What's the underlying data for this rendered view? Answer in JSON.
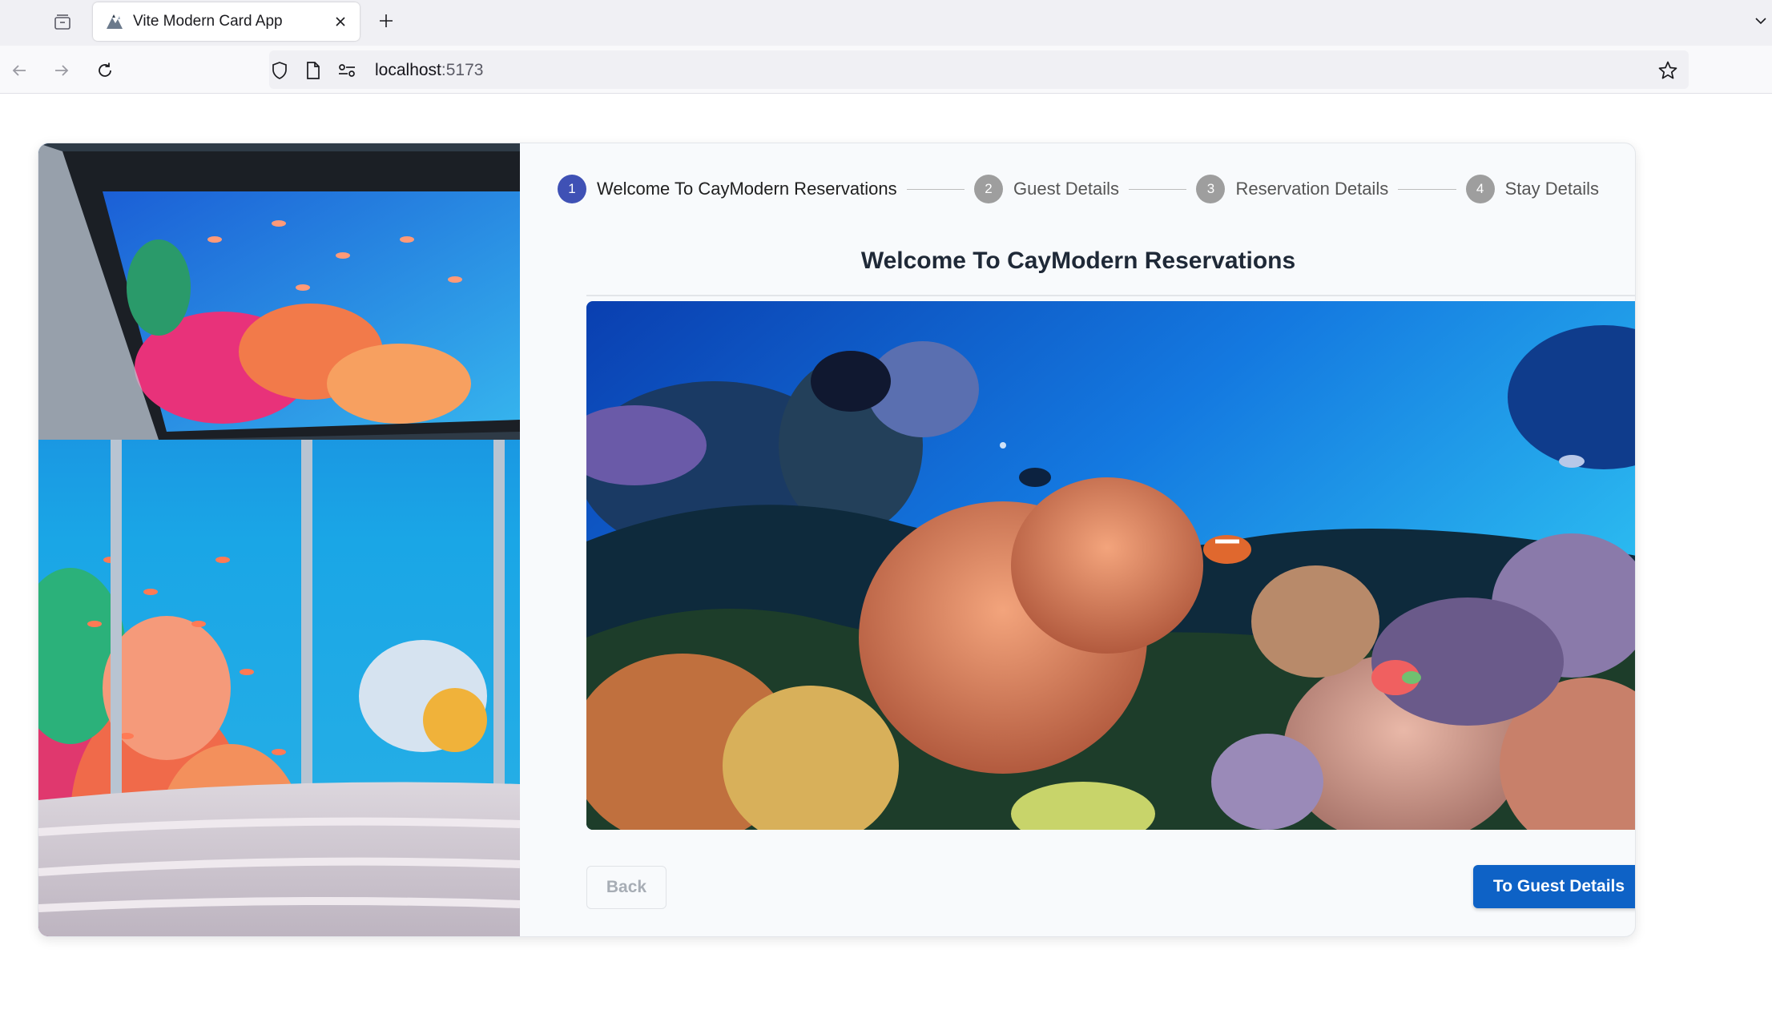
{
  "browser": {
    "tab_title": "Vite Modern Card App",
    "url_host": "localhost",
    "url_port": ":5173",
    "icons": {
      "tab_manager": "tab-manager-icon",
      "favicon": "vite-favicon-icon",
      "close": "close-icon",
      "new_tab": "plus-icon",
      "overflow": "chevron-down-icon",
      "back": "arrow-left-icon",
      "forward": "arrow-right-icon",
      "reload": "reload-icon",
      "shield": "shield-icon",
      "page": "page-icon",
      "permissions": "permissions-icon",
      "bookmark": "star-icon"
    }
  },
  "stepper": {
    "steps": [
      {
        "number": "1",
        "label": "Welcome To CayModern Reservations",
        "active": true
      },
      {
        "number": "2",
        "label": "Guest Details",
        "active": false
      },
      {
        "number": "3",
        "label": "Reservation Details",
        "active": false
      },
      {
        "number": "4",
        "label": "Stay Details",
        "active": false
      }
    ]
  },
  "main": {
    "title": "Welcome To CayModern Reservations",
    "side_image": "underwater-hotel-room-image",
    "hero_image": "coral-reef-image"
  },
  "actions": {
    "back_label": "Back",
    "next_label": "To Guest Details"
  },
  "colors": {
    "active_step": "#3f51b5",
    "inactive_step": "#9e9e9e",
    "primary_button": "#0e62c6"
  }
}
